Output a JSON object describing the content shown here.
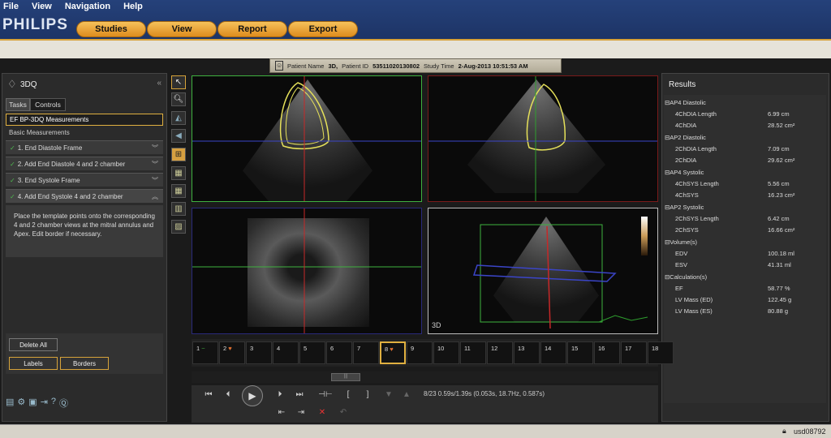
{
  "menu": [
    "File",
    "View",
    "Navigation",
    "Help"
  ],
  "brand": "PHILIPS",
  "nav": {
    "studies": "Studies",
    "view": "View",
    "report": "Report",
    "export": "Export"
  },
  "patient": {
    "name_label": "Patient Name",
    "name": "3D,",
    "id_label": "Patient ID",
    "id": "53511020130802",
    "time_label": "Study Time",
    "time": "2-Aug-2013 10:51:53 AM"
  },
  "left": {
    "title": "3DQ",
    "tabs": {
      "tasks": "Tasks",
      "controls": "Controls"
    },
    "workflow": "EF BP-3DQ Measurements",
    "section": "Basic Measurements",
    "steps": [
      "1. End Diastole Frame",
      "2. Add End Diastole 4 and 2 chamber",
      "3. End Systole Frame",
      "4. Add End Systole 4 and 2 chamber"
    ],
    "instructions": "Place the template points onto the corresponding 4 and 2 chamber views at the mitral annulus and Apex. Edit border if necessary.",
    "delete_all": "Delete All",
    "labels": "Labels",
    "borders": "Borders"
  },
  "viewport": {
    "label_3d": "3D"
  },
  "results": {
    "title": "Results",
    "groups": [
      {
        "name": "AP4 Diastolic",
        "items": [
          {
            "n": "4ChDIA Length",
            "v": "6.99 cm"
          },
          {
            "n": "4ChDIA",
            "v": "28.52 cm²"
          }
        ]
      },
      {
        "name": "AP2 Diastolic",
        "items": [
          {
            "n": "2ChDIA Length",
            "v": "7.09 cm"
          },
          {
            "n": "2ChDIA",
            "v": "29.62 cm²"
          }
        ]
      },
      {
        "name": "AP4 Systolic",
        "items": [
          {
            "n": "4ChSYS Length",
            "v": "5.56 cm"
          },
          {
            "n": "4ChSYS",
            "v": "16.23 cm²"
          }
        ]
      },
      {
        "name": "AP2 Systolic",
        "items": [
          {
            "n": "2ChSYS Length",
            "v": "6.42 cm"
          },
          {
            "n": "2ChSYS",
            "v": "16.66 cm²"
          }
        ]
      },
      {
        "name": "Volume(s)",
        "items": [
          {
            "n": "EDV",
            "v": "100.18 ml"
          },
          {
            "n": "ESV",
            "v": "41.31 ml"
          }
        ]
      },
      {
        "name": "Calculation(s)",
        "items": [
          {
            "n": "EF",
            "v": "58.77 %"
          },
          {
            "n": "LV Mass (ED)",
            "v": "122.45 g"
          },
          {
            "n": "LV Mass (ES)",
            "v": "80.88 g"
          }
        ]
      }
    ]
  },
  "frames": [
    "1",
    "2",
    "3",
    "4",
    "5",
    "6",
    "7",
    "8",
    "9",
    "10",
    "11",
    "12",
    "13",
    "14",
    "15",
    "16",
    "17",
    "18"
  ],
  "playback": {
    "info": "8/23  0.59s/1.39s (0.053s, 18.7Hz, 0.587s)"
  },
  "status": {
    "user": "usd08792"
  }
}
